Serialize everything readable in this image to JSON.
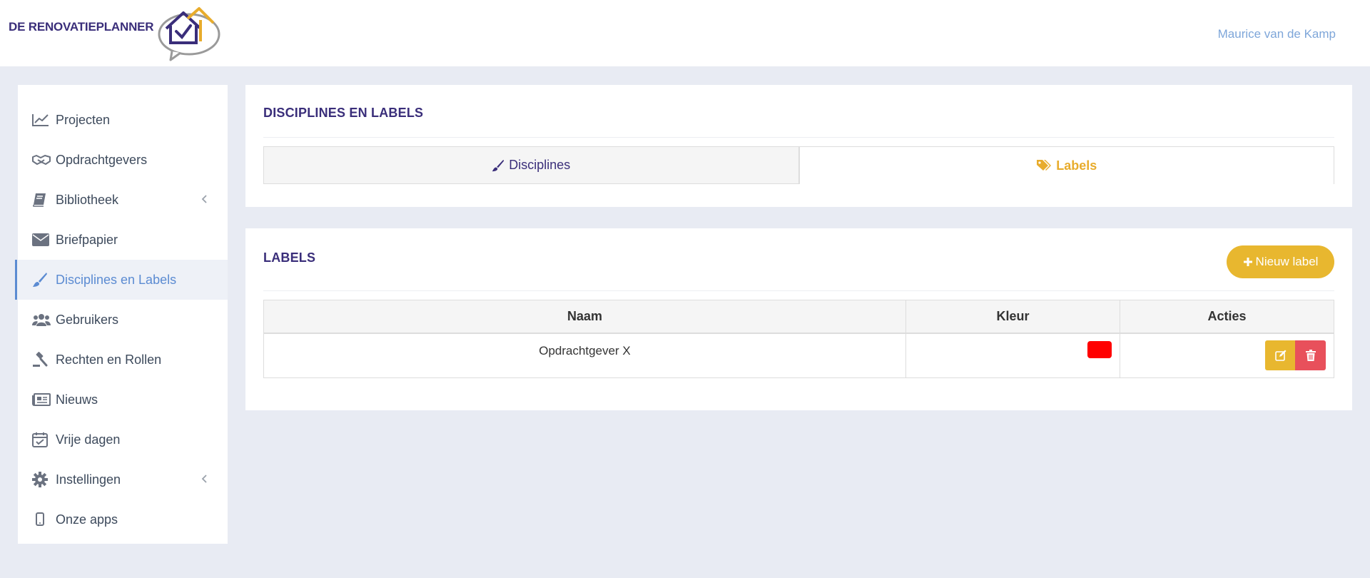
{
  "header": {
    "brand": "DE RENOVATIEPLANNER",
    "user_name": "Maurice van de Kamp"
  },
  "sidebar": {
    "items": [
      {
        "label": "Projecten",
        "icon": "chart-line-icon"
      },
      {
        "label": "Opdrachtgevers",
        "icon": "handshake-icon"
      },
      {
        "label": "Bibliotheek",
        "icon": "book-icon",
        "has_submenu": true
      },
      {
        "label": "Briefpapier",
        "icon": "envelope-icon"
      },
      {
        "label": "Disciplines en Labels",
        "icon": "paint-brush-icon",
        "active": true
      },
      {
        "label": "Gebruikers",
        "icon": "users-icon"
      },
      {
        "label": "Rechten en Rollen",
        "icon": "gavel-icon"
      },
      {
        "label": "Nieuws",
        "icon": "newspaper-icon"
      },
      {
        "label": "Vrije dagen",
        "icon": "calendar-check-icon"
      },
      {
        "label": "Instellingen",
        "icon": "gear-icon",
        "has_submenu": true
      },
      {
        "label": "Onze apps",
        "icon": "mobile-icon"
      }
    ]
  },
  "top_card": {
    "title": "DISCIPLINES EN LABELS",
    "tabs": [
      {
        "label": "Disciplines",
        "icon": "paint-brush-icon",
        "active": false
      },
      {
        "label": "Labels",
        "icon": "tags-icon",
        "active": true
      }
    ]
  },
  "labels_card": {
    "title": "LABELS",
    "new_button": "Nieuw label",
    "table": {
      "columns": [
        "Naam",
        "Kleur",
        "Acties"
      ],
      "rows": [
        {
          "name": "Opdrachtgever X",
          "color": "#ff0000"
        }
      ]
    }
  },
  "colors": {
    "brand_purple": "#3a2e7a",
    "accent_yellow": "#e8b72f",
    "link_blue": "#5b8bd2",
    "danger_red": "#e8505b",
    "background": "#e8ebf3"
  }
}
